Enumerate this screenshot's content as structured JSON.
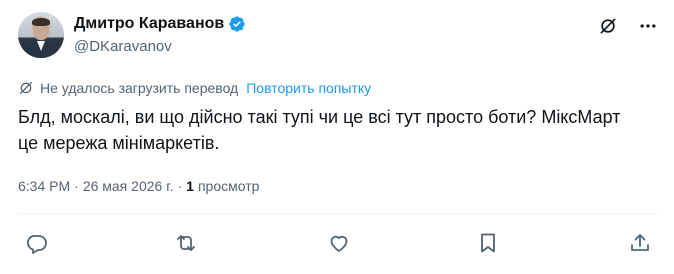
{
  "user": {
    "display_name": "Дмитро Караванов",
    "handle": "@DKaravanov",
    "verified_color": "#1d9bf0"
  },
  "header_icons": [
    "grok-translate-icon",
    "more-icon"
  ],
  "translation": {
    "status": "Не удалось загрузить перевод",
    "retry": "Повторить попытку"
  },
  "tweet": {
    "text": "Блд, москалі, ви що дійсно такі тупі чи це всі тут просто боти? МіксМарт\nце мережа мінімаркетів."
  },
  "meta": {
    "time": "6:34 PM",
    "separator": "·",
    "date": "26 мая 2026 г.",
    "separator2": "·",
    "views_count": "1",
    "views_label": "просмотр"
  },
  "actions": [
    "reply-icon",
    "retweet-icon",
    "like-icon",
    "bookmark-icon",
    "share-icon"
  ],
  "colors": {
    "text": "#0f1419",
    "secondary": "#536471",
    "accent": "#1d9bf0",
    "border": "#eff3f4"
  }
}
